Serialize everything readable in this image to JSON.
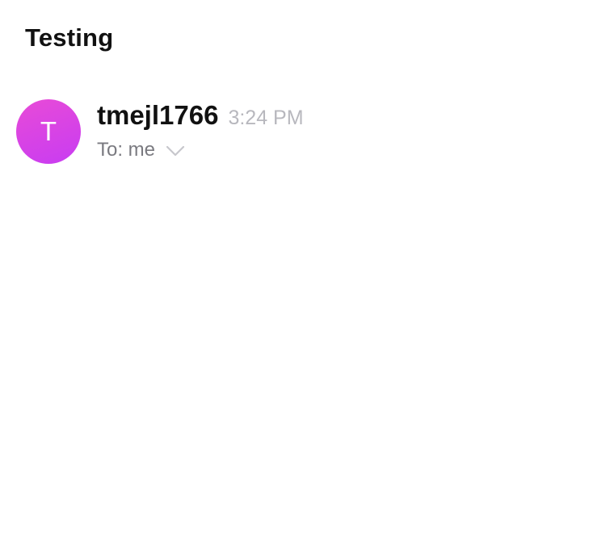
{
  "email": {
    "subject": "Testing",
    "sender": {
      "avatar_initial": "T",
      "name": "tmejl1766",
      "avatar_gradient_start": "#e84bd7",
      "avatar_gradient_end": "#c83cf2"
    },
    "time": "3:24 PM",
    "recipients_label": "To: me",
    "expand_icon": "chevron-down-icon"
  },
  "colors": {
    "subject_text": "#111111",
    "timestamp_text": "#b8b8be",
    "recipient_text": "#7a7a80",
    "chevron": "#c7c7cc"
  }
}
